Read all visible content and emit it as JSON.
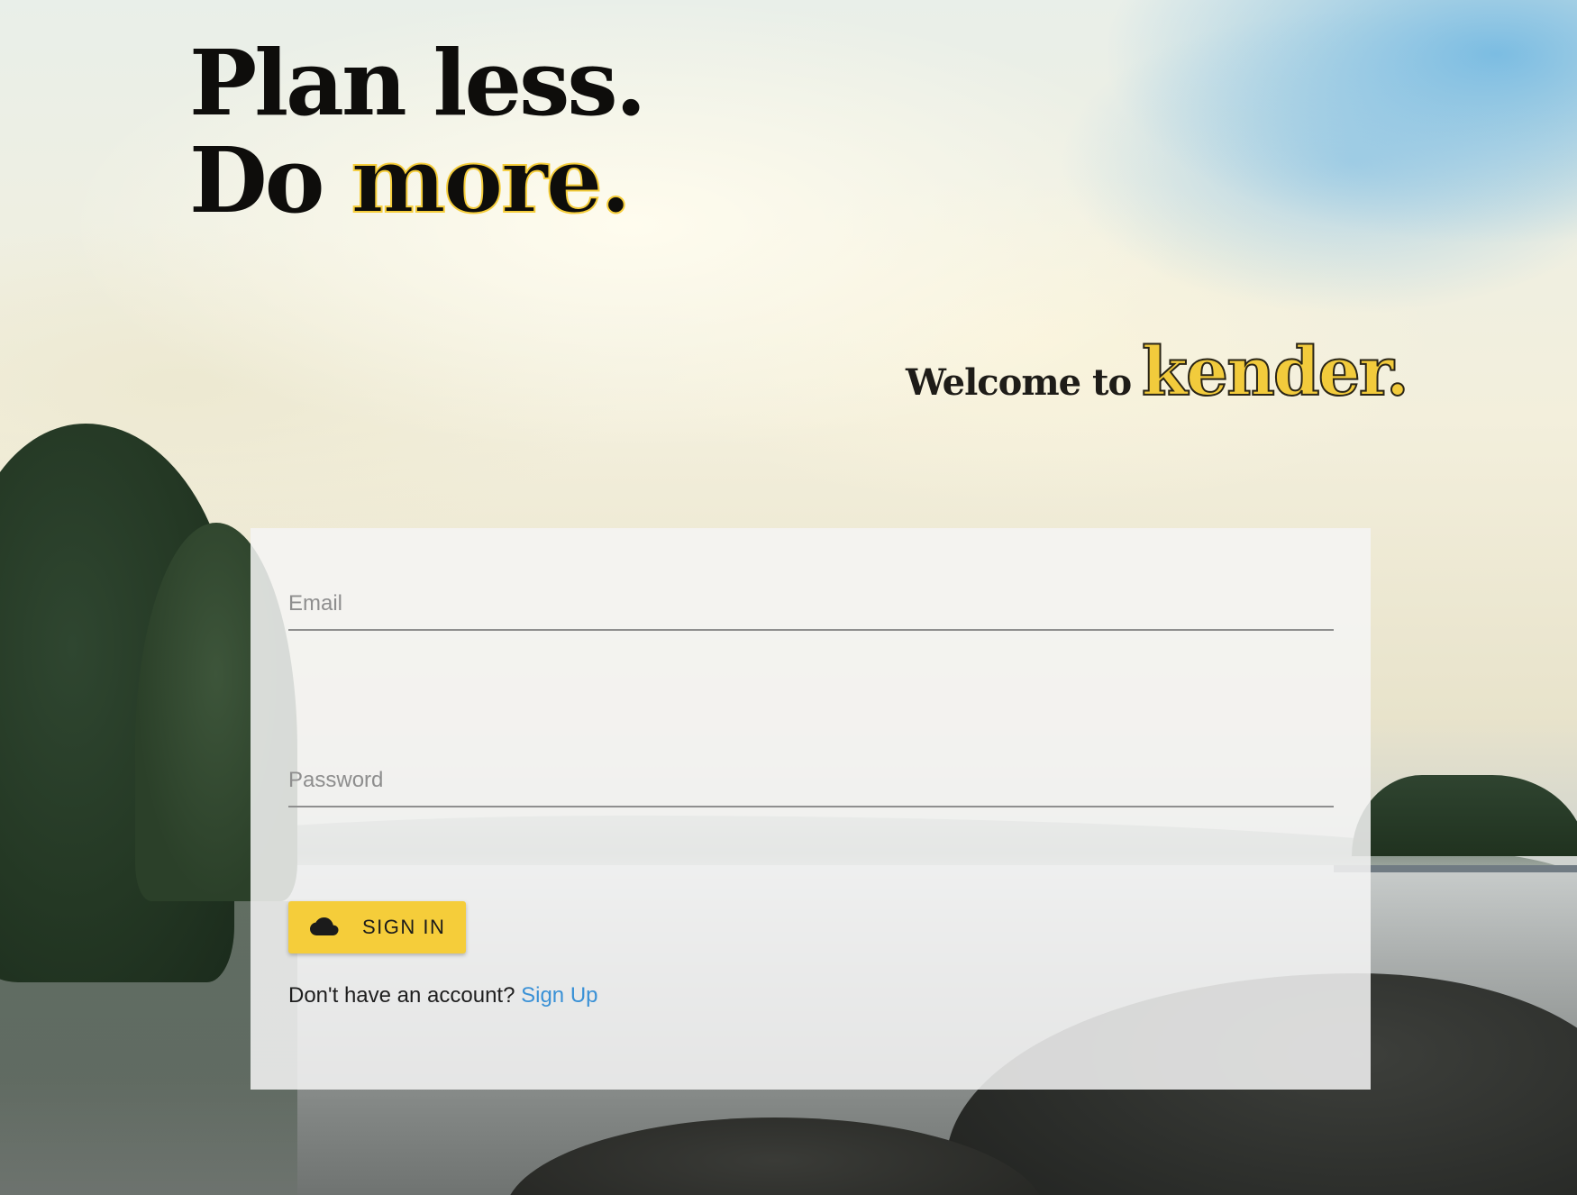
{
  "hero": {
    "line1": "Plan less.",
    "line2_prefix": "Do ",
    "line2_accent": "more."
  },
  "welcome": {
    "prefix": "Welcome to",
    "brand": "kender."
  },
  "login_form": {
    "email_placeholder": "Email",
    "password_placeholder": "Password",
    "signin_label": "SIGN IN",
    "signin_icon": "cloud-icon",
    "account_prompt": "Don't have an account?",
    "signup_link": "Sign Up"
  },
  "colors": {
    "accent_yellow": "#f5cd3a",
    "link_blue": "#3a91d6",
    "headline_black": "#0e0d0b"
  }
}
